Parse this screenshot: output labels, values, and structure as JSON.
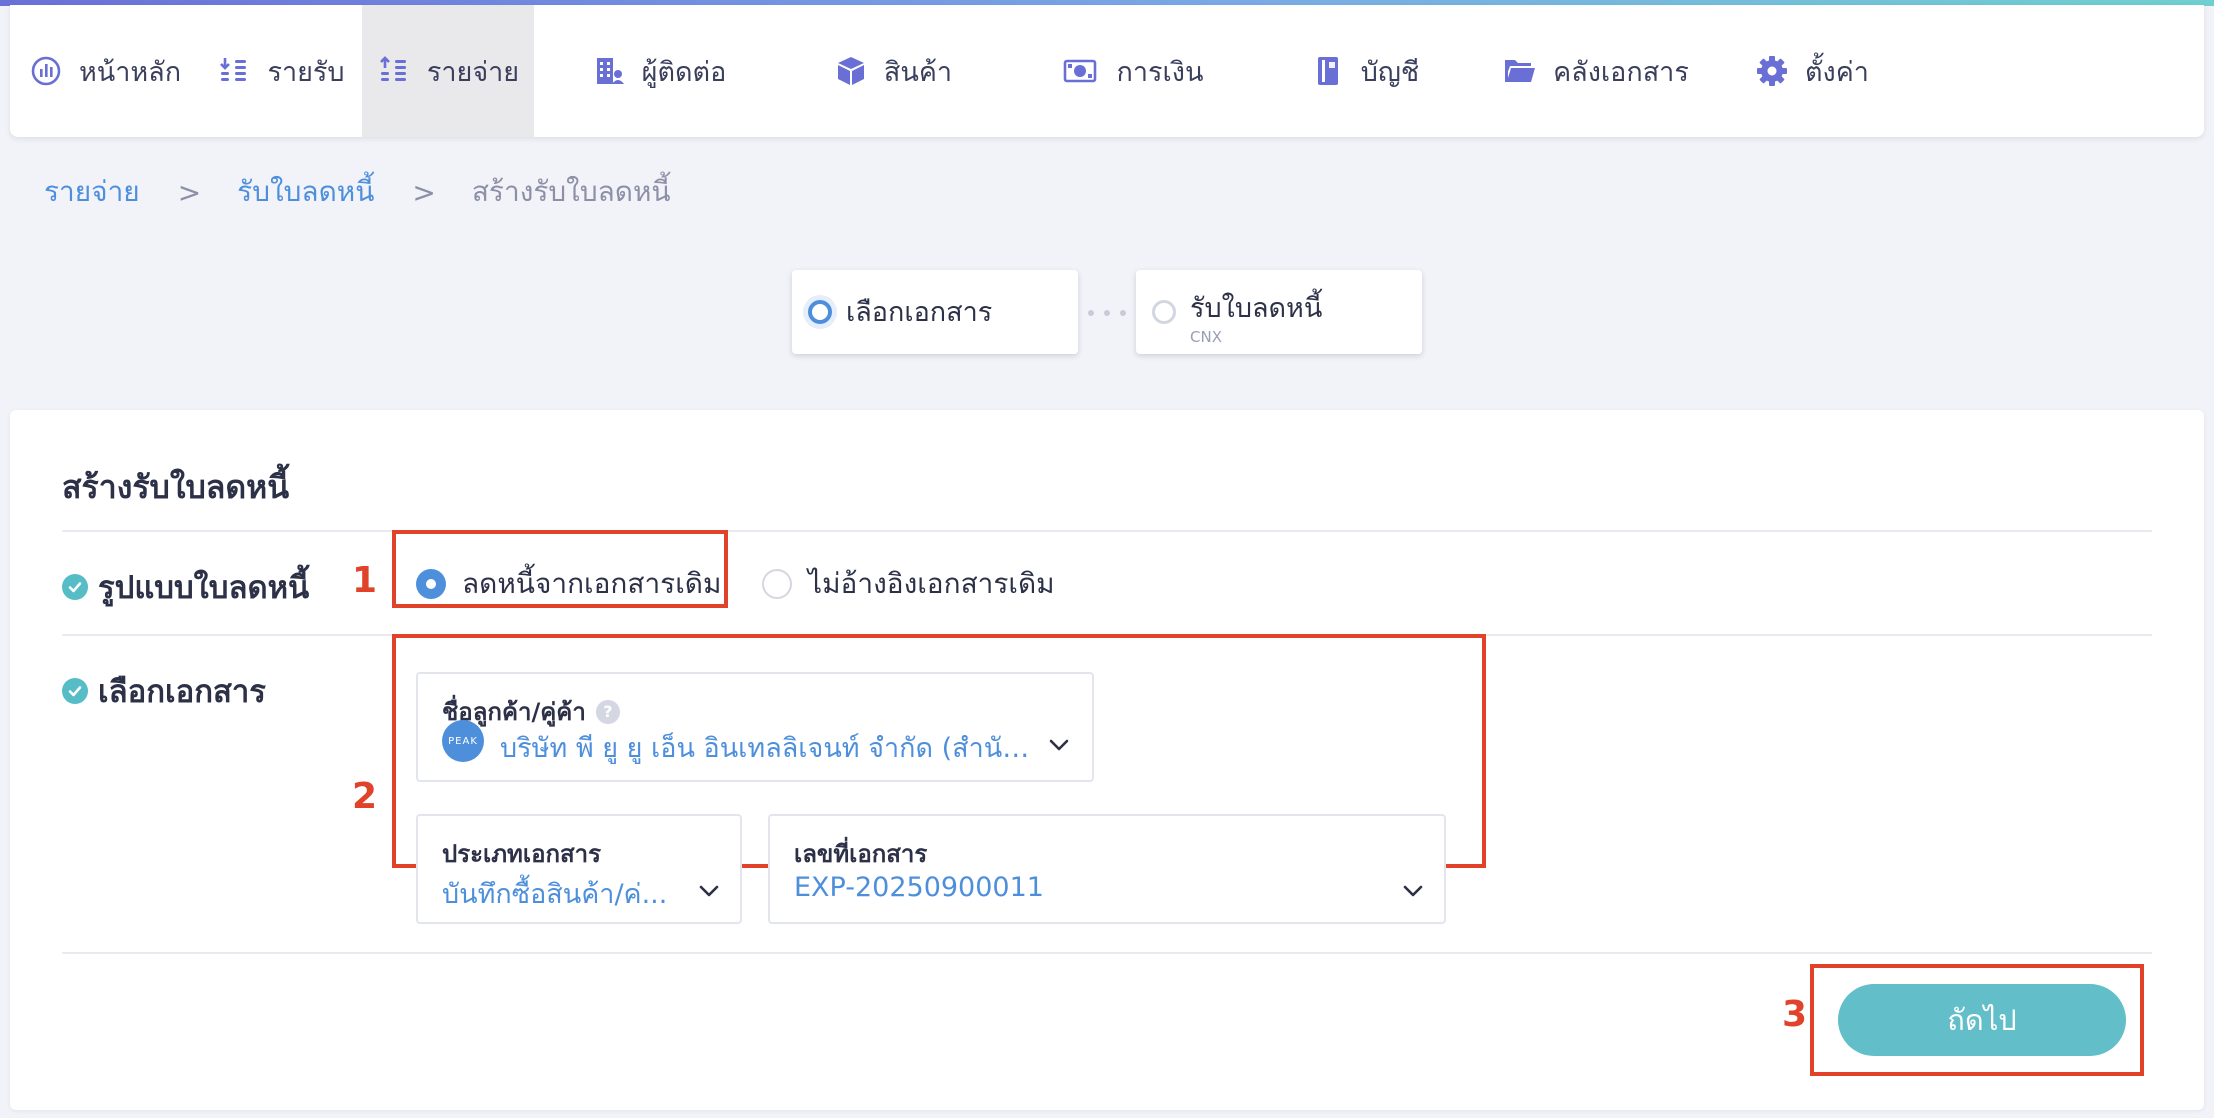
{
  "nav": {
    "items": [
      {
        "label": "หน้าหลัก",
        "icon": "dashboard-gauge-icon"
      },
      {
        "label": "รายรับ",
        "icon": "income-coins-icon"
      },
      {
        "label": "รายจ่าย",
        "icon": "expense-coins-icon",
        "active": true
      },
      {
        "label": "ผู้ติดต่อ",
        "icon": "contacts-building-icon"
      },
      {
        "label": "สินค้า",
        "icon": "product-box-icon"
      },
      {
        "label": "การเงิน",
        "icon": "finance-money-icon"
      },
      {
        "label": "บัญชี",
        "icon": "accounting-book-icon"
      },
      {
        "label": "คลังเอกสาร",
        "icon": "documents-folder-icon"
      },
      {
        "label": "ตั้งค่า",
        "icon": "settings-gear-icon"
      }
    ]
  },
  "breadcrumb": {
    "level1": "รายจ่าย",
    "sep": ">",
    "level2": "รับใบลดหนี้",
    "current": "สร้างรับใบลดหนี้"
  },
  "stepper": {
    "step1": {
      "title": "เลือกเอกสาร"
    },
    "step2": {
      "title": "รับใบลดหนี้",
      "subtitle": "CNX"
    }
  },
  "form": {
    "title": "สร้างรับใบลดหนี้",
    "format_label": "รูปแบบใบลดหนี้",
    "format_option_ref": "ลดหนี้จากเอกสารเดิม",
    "format_option_noref": "ไม่อ้างอิงเอกสารเดิม",
    "select_doc_label": "เลือกเอกสาร",
    "contact": {
      "label": "ชื่อลูกค้า/คู่ค้า",
      "help": "?",
      "logo_text": "PEAK",
      "value": "บริษัท พี ยู ยู เอ็น อินเทลลิเจนท์ จำกัด (สำนัก..."
    },
    "doc_type": {
      "label": "ประเภทเอกสาร",
      "value": "บันทึกซื้อสินค้า/ค่..."
    },
    "doc_number": {
      "label": "เลขที่เอกสาร",
      "value": "EXP-20250900011"
    },
    "next_button": "ถัดไป"
  },
  "annotations": [
    "1",
    "2",
    "3"
  ],
  "colors": {
    "accent_blue": "#4e8fdc",
    "teal_button": "#62bfc9",
    "annotation_red": "#e1432a",
    "active_nav_bg": "#e9e9ec",
    "icon_purple": "#6a6fd6"
  }
}
